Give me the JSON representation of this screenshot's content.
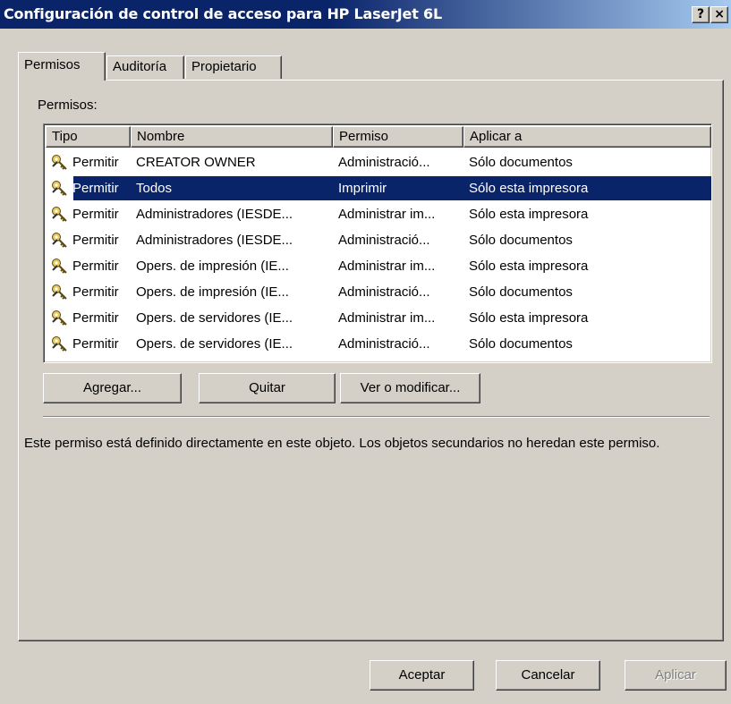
{
  "window": {
    "title": "Configuración de control de acceso para HP LaserJet 6L",
    "help_label": "?",
    "close_label": "×"
  },
  "tabs": [
    {
      "label": "Permisos",
      "active": true
    },
    {
      "label": "Auditoría",
      "active": false
    },
    {
      "label": "Propietario",
      "active": false
    }
  ],
  "permissions": {
    "section_label": "Permisos:",
    "columns": [
      "Tipo",
      "Nombre",
      "Permiso",
      "Aplicar a"
    ],
    "rows": [
      {
        "tipo": "Permitir",
        "nombre": "CREATOR OWNER",
        "permiso": "Administració...",
        "aplicar": "Sólo documentos",
        "selected": false
      },
      {
        "tipo": "Permitir",
        "nombre": "Todos",
        "permiso": "Imprimir",
        "aplicar": "Sólo esta impresora",
        "selected": true
      },
      {
        "tipo": "Permitir",
        "nombre": "Administradores (IESDE...",
        "permiso": "Administrar im...",
        "aplicar": "Sólo esta impresora",
        "selected": false
      },
      {
        "tipo": "Permitir",
        "nombre": "Administradores (IESDE...",
        "permiso": "Administració...",
        "aplicar": "Sólo documentos",
        "selected": false
      },
      {
        "tipo": "Permitir",
        "nombre": "Opers. de impresión (IE...",
        "permiso": "Administrar im...",
        "aplicar": "Sólo esta impresora",
        "selected": false
      },
      {
        "tipo": "Permitir",
        "nombre": "Opers. de impresión (IE...",
        "permiso": "Administració...",
        "aplicar": "Sólo documentos",
        "selected": false
      },
      {
        "tipo": "Permitir",
        "nombre": "Opers. de servidores (IE...",
        "permiso": "Administrar im...",
        "aplicar": "Sólo esta impresora",
        "selected": false
      },
      {
        "tipo": "Permitir",
        "nombre": "Opers. de servidores (IE...",
        "permiso": "Administració...",
        "aplicar": "Sólo documentos",
        "selected": false
      }
    ],
    "add_label": "Agregar...",
    "remove_label": "Quitar",
    "view_label": "Ver o modificar...",
    "description": "Este permiso está definido directamente en este objeto. Los objetos secundarios no heredan este permiso."
  },
  "footer": {
    "ok_label": "Aceptar",
    "cancel_label": "Cancelar",
    "apply_label": "Aplicar"
  },
  "icons": {
    "row_icon": "key-icon"
  },
  "colors": {
    "titlebar": "#0a246a",
    "selection": "#0a246a",
    "face": "#d4d0c8"
  }
}
